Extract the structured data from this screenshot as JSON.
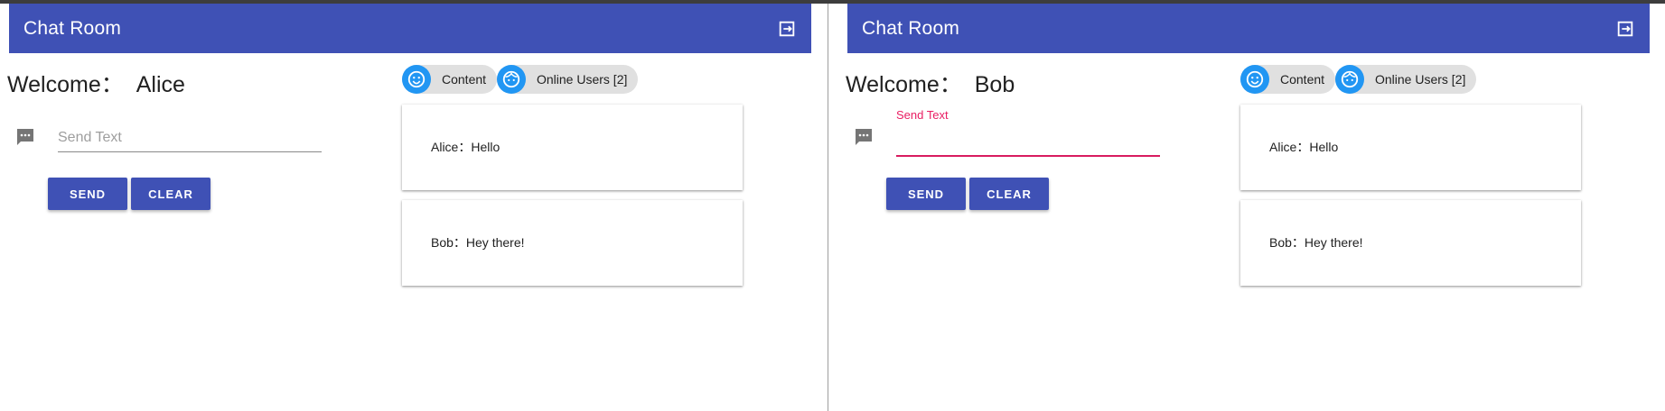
{
  "app": {
    "title": "Chat Room"
  },
  "panels": [
    {
      "user": "Alice",
      "welcome_label": "Welcome：",
      "input": {
        "label": "Send Text",
        "placeholder": "Send Text",
        "value": ""
      },
      "buttons": {
        "send": "SEND",
        "clear": "CLEAR"
      },
      "chips": {
        "content": "Content",
        "online": "Online Users [2]"
      },
      "messages": [
        {
          "text": "Alice：Hello"
        },
        {
          "text": "Bob：Hey there!"
        }
      ]
    },
    {
      "user": "Bob",
      "welcome_label": "Welcome：",
      "input": {
        "label": "Send Text",
        "placeholder": "",
        "value": ""
      },
      "buttons": {
        "send": "SEND",
        "clear": "CLEAR"
      },
      "chips": {
        "content": "Content",
        "online": "Online Users [2]"
      },
      "messages": [
        {
          "text": "Alice：Hello"
        },
        {
          "text": "Bob：Hey there!"
        }
      ]
    }
  ],
  "colors": {
    "primary": "#3f51b5",
    "accent": "#e91e63",
    "chip_avatar": "#2196f3"
  },
  "icons": [
    "logout-icon",
    "message-icon",
    "smiley-icon",
    "face-icon"
  ]
}
